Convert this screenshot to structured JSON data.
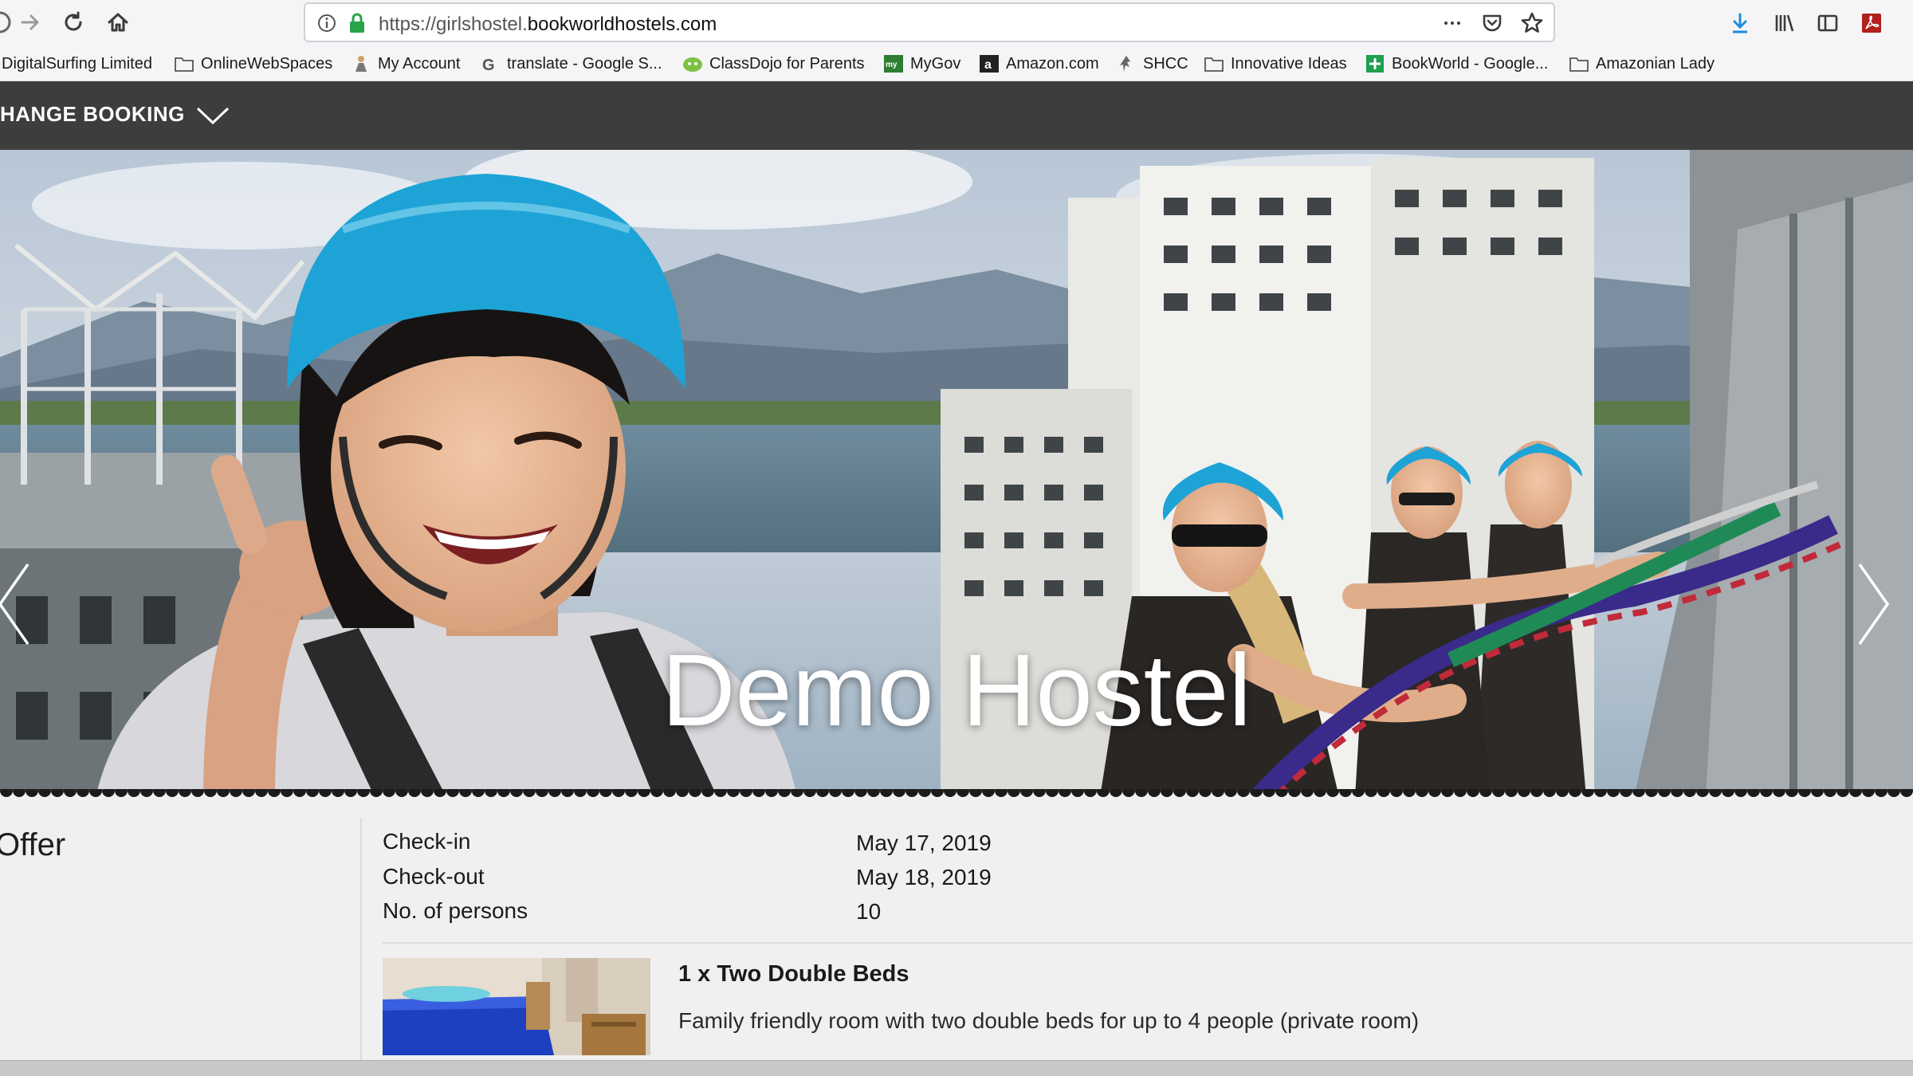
{
  "browser": {
    "url_prefix": "https://girlshostel.",
    "url_domain": "bookworldhostels.com",
    "bookmarks": [
      {
        "label": "DigitalSurfing Limited",
        "icon": "none"
      },
      {
        "label": "OnlineWebSpaces",
        "icon": "folder-icon"
      },
      {
        "label": "My Account",
        "icon": "account-icon"
      },
      {
        "label": "translate - Google S...",
        "icon": "google-icon"
      },
      {
        "label": "ClassDojo for Parents",
        "icon": "classdojo-icon"
      },
      {
        "label": "MyGov",
        "icon": "mygov-icon"
      },
      {
        "label": "Amazon.com",
        "icon": "amazon-icon"
      },
      {
        "label": "SHCC",
        "icon": "shcc-icon"
      },
      {
        "label": "Innovative Ideas",
        "icon": "folder-icon"
      },
      {
        "label": "BookWorld - Google...",
        "icon": "sheets-icon"
      },
      {
        "label": "Amazonian Lady",
        "icon": "folder-icon"
      }
    ]
  },
  "header": {
    "change_booking_label": "HANGE BOOKING"
  },
  "hero": {
    "title": "Demo Hostel"
  },
  "booking": {
    "section_title": "Offer",
    "details": [
      {
        "label": "Check-in",
        "value": "May 17, 2019"
      },
      {
        "label": "Check-out",
        "value": "May 18, 2019"
      },
      {
        "label": "No. of persons",
        "value": "10"
      }
    ],
    "room": {
      "title": "1 x Two Double Beds",
      "description": "Family friendly room with two double beds for up to 4 people (private room)"
    }
  },
  "colors": {
    "header_bg": "#3d3d3d",
    "content_bg": "#f0f0f0",
    "helmet": "#1ea3d6"
  }
}
